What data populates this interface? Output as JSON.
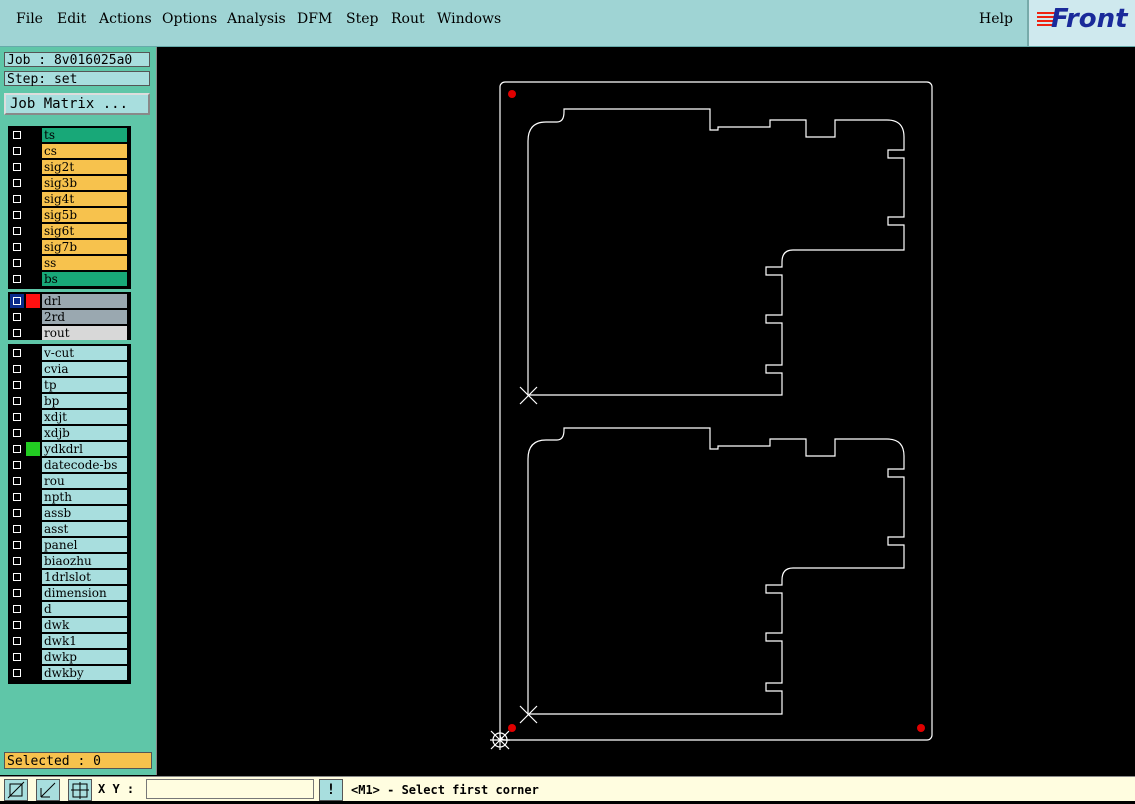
{
  "menu": {
    "file": "File",
    "edit": "Edit",
    "actions": "Actions",
    "options": "Options",
    "analysis": "Analysis",
    "dfm": "DFM",
    "step": "Step",
    "rout": "Rout",
    "windows": "Windows",
    "help": "Help"
  },
  "logo": {
    "text": "Front"
  },
  "job": {
    "label": "Job : 8v016025a0",
    "step": "Step: set",
    "matrix_button": "Job Matrix ..."
  },
  "layers": [
    {
      "name": "ts",
      "color": "#18a878"
    },
    {
      "name": "cs",
      "color": "#f7c24d"
    },
    {
      "name": "sig2t",
      "color": "#f7c24d"
    },
    {
      "name": "sig3b",
      "color": "#f7c24d"
    },
    {
      "name": "sig4t",
      "color": "#f7c24d"
    },
    {
      "name": "sig5b",
      "color": "#f7c24d"
    },
    {
      "name": "sig6t",
      "color": "#f7c24d"
    },
    {
      "name": "sig7b",
      "color": "#f7c24d"
    },
    {
      "name": "ss",
      "color": "#f7c24d"
    },
    {
      "name": "bs",
      "color": "#18a878"
    },
    {
      "name": "drl",
      "color": "#9aa8b0"
    },
    {
      "name": "2rd",
      "color": "#9aa8b0"
    },
    {
      "name": "rout",
      "color": "#d8d8d8"
    },
    {
      "name": "v-cut",
      "color": "#a8dede"
    },
    {
      "name": "cvia",
      "color": "#a8dede"
    },
    {
      "name": "tp",
      "color": "#a8dede"
    },
    {
      "name": "bp",
      "color": "#a8dede"
    },
    {
      "name": "xdjt",
      "color": "#a8dede"
    },
    {
      "name": "xdjb",
      "color": "#a8dede"
    },
    {
      "name": "ydkdrl",
      "color": "#a8dede"
    },
    {
      "name": "datecode-bs",
      "color": "#a8dede"
    },
    {
      "name": "rou",
      "color": "#a8dede"
    },
    {
      "name": "npth",
      "color": "#a8dede"
    },
    {
      "name": "assb",
      "color": "#a8dede"
    },
    {
      "name": "asst",
      "color": "#a8dede"
    },
    {
      "name": "panel",
      "color": "#a8dede"
    },
    {
      "name": "biaozhu",
      "color": "#a8dede"
    },
    {
      "name": "1drlslot",
      "color": "#a8dede"
    },
    {
      "name": "dimension",
      "color": "#a8dede"
    },
    {
      "name": "d",
      "color": "#a8dede"
    },
    {
      "name": "dwk",
      "color": "#a8dede"
    },
    {
      "name": "dwk1",
      "color": "#a8dede"
    },
    {
      "name": "dwkp",
      "color": "#a8dede"
    },
    {
      "name": "dwkby",
      "color": "#a8dede"
    }
  ],
  "selected": "Selected : 0",
  "status": {
    "xy_label": "X Y :",
    "xy_value": "",
    "warn": "!",
    "prompt": "<M1> - Select first corner"
  },
  "colors": {
    "accent": "#5fc6a8",
    "canvas": "#000000",
    "outline": "#ffffff",
    "drill": "#e00000"
  }
}
